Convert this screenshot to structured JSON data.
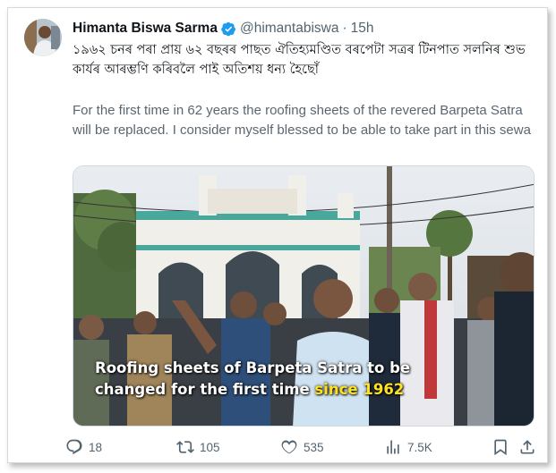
{
  "tweet": {
    "author_name": "Himanta Biswa Sarma",
    "handle": "@himantabiswa",
    "separator": "·",
    "time": "15h",
    "text_assamese": "১৯৬২ চনৰ পৰা প্ৰায় ৬২ বছৰৰ পাছত ঐতিহ্যমণ্ডিত বৰপেটা সত্ৰৰ টিনপাত সলনিৰ শুভ কাৰ্যৰ আৰম্ভণি কৰিবলৈ পাই অতিশয় ধন্য হৈছোঁ",
    "text_english": "For the first time in 62 years the roofing sheets of the revered Barpeta Satra will be replaced. I consider myself blessed to be able to take part in this sewa"
  },
  "media": {
    "caption_line1": "Roofing sheets of Barpeta Satra to be",
    "caption_line2_plain": "changed for the first time ",
    "caption_line2_highlight": "since 1962",
    "highlight_color": "#ffe21a"
  },
  "actions": {
    "replies": "18",
    "retweets": "105",
    "likes": "535",
    "views": "7.5K"
  },
  "icons": [
    "verified-badge-icon",
    "reply-icon",
    "retweet-icon",
    "like-icon",
    "views-icon",
    "bookmark-icon",
    "share-icon"
  ],
  "colors": {
    "verified": "#1d9bf0",
    "secondary_text": "#536471"
  }
}
